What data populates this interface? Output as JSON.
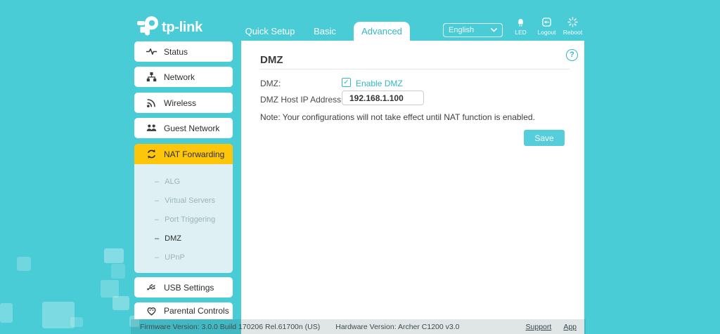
{
  "header": {
    "brand": "tp-link",
    "tabs": [
      {
        "label": "Quick Setup",
        "active": false
      },
      {
        "label": "Basic",
        "active": false
      },
      {
        "label": "Advanced",
        "active": true
      }
    ],
    "language": {
      "value": "English"
    },
    "actions": [
      {
        "label": "LED",
        "icon": "led-icon"
      },
      {
        "label": "Logout",
        "icon": "logout-icon"
      },
      {
        "label": "Reboot",
        "icon": "reboot-icon"
      }
    ]
  },
  "sidebar": {
    "items": [
      {
        "label": "Status",
        "icon": "status-icon",
        "active": false
      },
      {
        "label": "Network",
        "icon": "network-icon",
        "active": false
      },
      {
        "label": "Wireless",
        "icon": "wireless-icon",
        "active": false
      },
      {
        "label": "Guest Network",
        "icon": "guest-network-icon",
        "active": false
      },
      {
        "label": "NAT Forwarding",
        "icon": "nat-forwarding-icon",
        "active": true
      },
      {
        "label": "USB Settings",
        "icon": "usb-icon",
        "active": false
      },
      {
        "label": "Parental Controls",
        "icon": "parental-controls-icon",
        "active": false
      }
    ],
    "submenu": [
      {
        "label": "ALG",
        "active": false
      },
      {
        "label": "Virtual Servers",
        "active": false
      },
      {
        "label": "Port Triggering",
        "active": false
      },
      {
        "label": "DMZ",
        "active": true
      },
      {
        "label": "UPnP",
        "active": false
      }
    ]
  },
  "main": {
    "title": "DMZ",
    "fields": [
      {
        "label": "DMZ:",
        "type": "checkbox",
        "checked": true,
        "checkbox_label": "Enable DMZ"
      },
      {
        "label": "DMZ Host IP Address:",
        "type": "text",
        "value": "192.168.1.100"
      }
    ],
    "note": "Note: Your configurations will not take effect until NAT function is enabled.",
    "save_label": "Save"
  },
  "footer": {
    "firmware": "Firmware Version: 3.0.0 Build 170206 Rel.61700n (US)",
    "hardware": "Hardware Version: Archer C1200 v3.0",
    "links": [
      {
        "label": "Support"
      },
      {
        "label": "App"
      }
    ]
  },
  "icons": {
    "check": "✓",
    "question": "?",
    "dash": "–"
  },
  "colors": {
    "accent": "#31b8c4",
    "header_teal": "#4accd7",
    "active_item_yellow": "#fdc60b"
  }
}
